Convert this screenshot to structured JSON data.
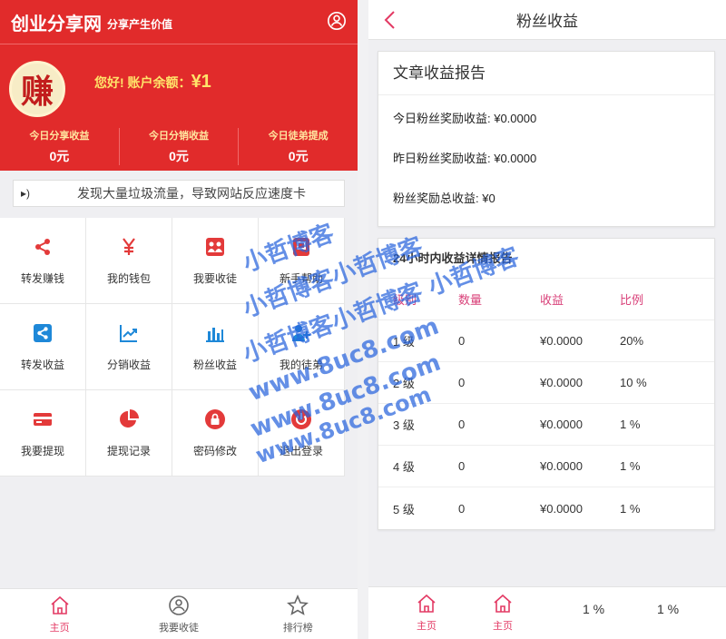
{
  "left": {
    "header": {
      "title": "创业分享网",
      "slogan": "分享产生价值"
    },
    "avatar_char": "赚",
    "balance": {
      "label": "您好! 账户余额：",
      "value": "¥1"
    },
    "stats": [
      {
        "label": "今日分享收益",
        "value": "0元"
      },
      {
        "label": "今日分销收益",
        "value": "0元"
      },
      {
        "label": "今日徒弟提成",
        "value": "0元"
      }
    ],
    "notice": "发现大量垃圾流量，导致网站反应速度卡",
    "menu": [
      {
        "label": "转发赚钱",
        "icon": "share-icon"
      },
      {
        "label": "我的钱包",
        "icon": "yen-icon"
      },
      {
        "label": "我要收徒",
        "icon": "group-icon"
      },
      {
        "label": "新手帮助",
        "icon": "help-icon"
      },
      {
        "label": "转发收益",
        "icon": "share-box-icon"
      },
      {
        "label": "分销收益",
        "icon": "trend-icon"
      },
      {
        "label": "粉丝收益",
        "icon": "bar-chart-icon"
      },
      {
        "label": "我的徒弟",
        "icon": "add-user-icon"
      },
      {
        "label": "我要提现",
        "icon": "card-icon"
      },
      {
        "label": "提现记录",
        "icon": "pie-icon"
      },
      {
        "label": "密码修改",
        "icon": "lock-icon"
      },
      {
        "label": "退出登录",
        "icon": "power-icon"
      }
    ],
    "tabs": [
      {
        "label": "主页"
      },
      {
        "label": "我要收徒"
      },
      {
        "label": "排行榜"
      }
    ]
  },
  "right": {
    "title": "粉丝收益",
    "article_report": {
      "title": "文章收益报告",
      "lines": [
        "今日粉丝奖励收益: ¥0.0000",
        "昨日粉丝奖励收益: ¥0.0000",
        "粉丝奖励总收益: ¥0"
      ]
    },
    "detail_report": {
      "title": "24小时内收益详情报告",
      "headers": [
        "级别",
        "数量",
        "收益",
        "比例"
      ],
      "rows": [
        [
          "1 级",
          "0",
          "¥0.0000",
          "20%"
        ],
        [
          "2 级",
          "0",
          "¥0.0000",
          "10 %"
        ],
        [
          "3 级",
          "0",
          "¥0.0000",
          "1 %"
        ],
        [
          "4 级",
          "0",
          "¥0.0000",
          "1 %"
        ],
        [
          "5 级",
          "0",
          "¥0.0000",
          "1 %"
        ]
      ]
    },
    "bottom": {
      "tab1": "主页",
      "tab2": "主页",
      "pct1": "1 %",
      "pct2": "1 %"
    }
  },
  "watermark": [
    "小哲博客",
    "小哲博客小哲博客",
    "小哲博客小哲博客 小哲博客",
    "www.8uc8.com",
    "www.8uc8.com",
    "www.8uc8.com"
  ],
  "colors": {
    "brand_red": "#e12b2b",
    "accent_pink": "#e33a64",
    "balance_yellow": "#ffe46a"
  }
}
